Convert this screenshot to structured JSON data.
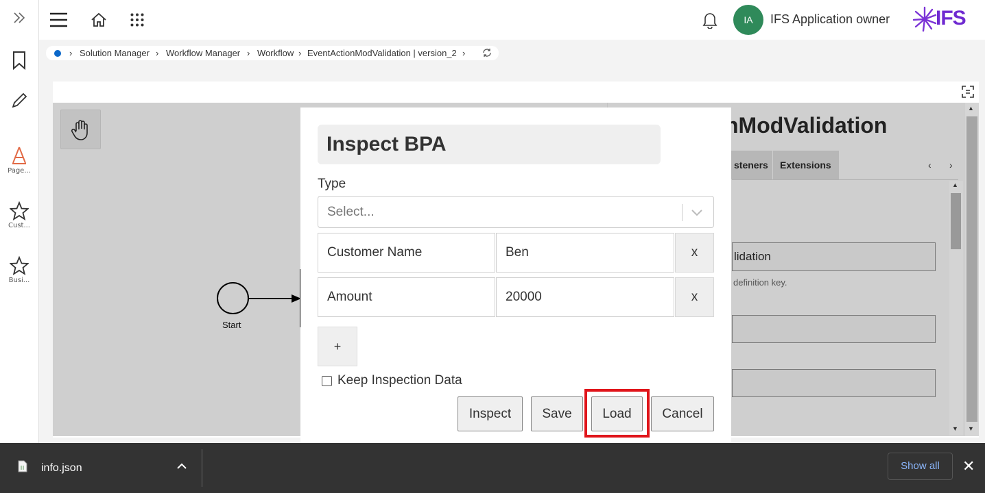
{
  "rail": {
    "items": [
      {
        "label": "Page..."
      },
      {
        "label": "Cust..."
      },
      {
        "label": "Busi..."
      }
    ]
  },
  "topbar": {
    "avatar_initials": "IA",
    "user_name": "IFS Application owner",
    "logo_text": "IFS"
  },
  "breadcrumb": {
    "items": [
      "Solution Manager",
      "Workflow Manager",
      "Workflow",
      "EventActionModValidation | version_2"
    ]
  },
  "diagram": {
    "start_label": "Start"
  },
  "properties": {
    "title": "nModValidation",
    "tabs": [
      "steners",
      "Extensions"
    ],
    "name_value": "lidation",
    "hint": "definition key."
  },
  "dialog": {
    "title": "Inspect BPA",
    "type_label": "Type",
    "type_placeholder": "Select...",
    "rows": [
      {
        "key": "Customer Name",
        "value": "Ben",
        "remove": "x"
      },
      {
        "key": "Amount",
        "value": "20000",
        "remove": "x"
      }
    ],
    "add_label": "+",
    "keep_label": "Keep Inspection Data",
    "buttons": {
      "inspect": "Inspect",
      "save": "Save",
      "load": "Load",
      "cancel": "Cancel"
    }
  },
  "downloads": {
    "file_name": "info.json",
    "show_all": "Show all"
  },
  "colors": {
    "brand": "#6f2ad1",
    "avatar": "#2f8a5a",
    "highlight": "#e0151b",
    "link": "#8ab4f8"
  }
}
